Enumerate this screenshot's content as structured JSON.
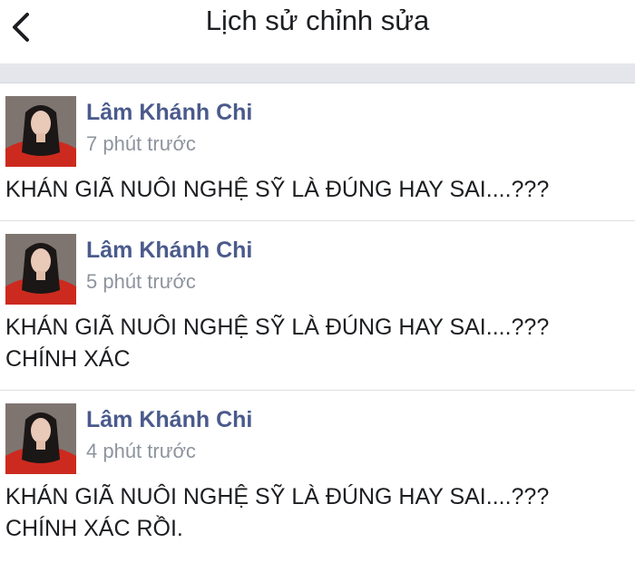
{
  "header": {
    "title": "Lịch sử chỉnh sửa",
    "back_icon": "chevron-left-icon"
  },
  "colors": {
    "name": "#4a5a8c",
    "timestamp": "#8d949e",
    "separator": "#e4e6eb",
    "avatar_bg": "#7f7570",
    "dress": "#cc2a1f"
  },
  "entries": [
    {
      "author": "Lâm Khánh Chi",
      "time": "7 phút trước",
      "text": "KHÁN GIÃ NUÔI NGHỆ SỸ LÀ ĐÚNG HAY SAI....???"
    },
    {
      "author": "Lâm Khánh Chi",
      "time": "5 phút trước",
      "text": "KHÁN GIÃ NUÔI NGHỆ SỸ LÀ ĐÚNG HAY SAI....???\nCHÍNH XÁC"
    },
    {
      "author": "Lâm Khánh Chi",
      "time": "4 phút trước",
      "text": "KHÁN GIÃ NUÔI NGHỆ SỸ LÀ ĐÚNG HAY SAI....???\nCHÍNH XÁC RỒI."
    }
  ]
}
